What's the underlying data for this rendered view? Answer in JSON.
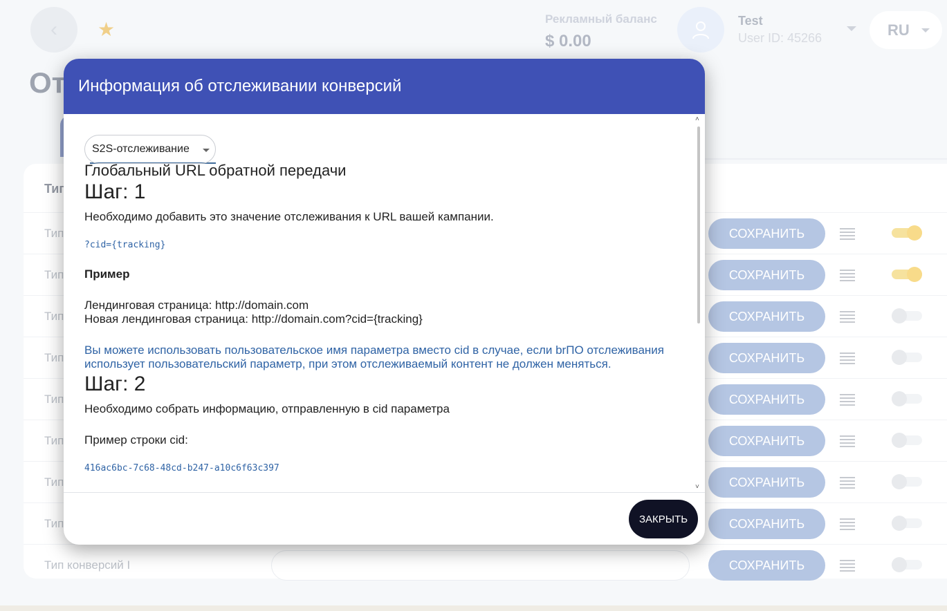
{
  "header": {
    "balance_label": "Рекламный баланс",
    "balance_value": "$ 0.00",
    "user_name": "Test",
    "user_id": "User ID: 45266",
    "language": "RU"
  },
  "page": {
    "title": "От",
    "table_header": "Тип"
  },
  "rows": [
    {
      "label": "Тип",
      "save": "СОХРАНИТЬ",
      "enabled": true
    },
    {
      "label": "Тип",
      "save": "СОХРАНИТЬ",
      "enabled": true
    },
    {
      "label": "Тип",
      "save": "СОХРАНИТЬ",
      "enabled": false
    },
    {
      "label": "Тип",
      "save": "СОХРАНИТЬ",
      "enabled": false
    },
    {
      "label": "Тип",
      "save": "СОХРАНИТЬ",
      "enabled": false
    },
    {
      "label": "Тип",
      "save": "СОХРАНИТЬ",
      "enabled": false
    },
    {
      "label": "Тип",
      "save": "СОХРАНИТЬ",
      "enabled": false
    },
    {
      "label": "Тип",
      "save": "СОХРАНИТЬ",
      "enabled": false
    },
    {
      "label": "Тип конверсий I",
      "save": "СОХРАНИТЬ",
      "enabled": false
    }
  ],
  "modal": {
    "title": "Информация об отслеживании конверсий",
    "select_value": "S2S-отслеживание",
    "heading": "Глобальный URL обратной передачи",
    "step1_title": "Шаг: 1",
    "step1_text": "Необходимо добавить это значение отслеживания к URL вашей кампании.",
    "step1_code": "?cid={tracking}",
    "example_label": "Пример",
    "example_line1": "Лендинговая страница: http://domain.com",
    "example_line2": "Новая лендинговая страница: http://domain.com?cid={tracking}",
    "note": "Вы можете использовать пользовательское имя параметра вместо cid в случае, если brПО отслеживания использует пользовательский параметр, при этом отслеживаемый контент не должен меняться.",
    "step2_title": "Шаг: 2",
    "step2_text": "Необходимо собрать информацию, отправленную в cid параметра",
    "cid_example_label": "Пример строки cid:",
    "cid_example_value": "416ac6bc-7c68-48cd-b247-a10c6f63c397",
    "close_label": "ЗАКРЫТЬ"
  },
  "colors": {
    "modal_header": "#3f51b5",
    "save_button": "#8ea8d4",
    "toggle_on": "#f5c84c",
    "close_button": "#101225",
    "code_text": "#2f63a5"
  }
}
